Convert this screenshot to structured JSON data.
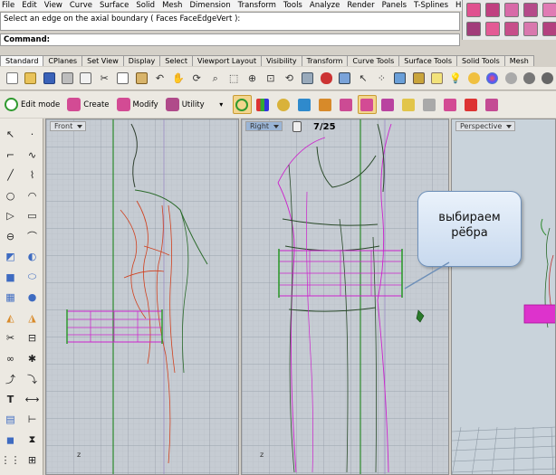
{
  "menu": [
    "File",
    "Edit",
    "View",
    "Curve",
    "Surface",
    "Solid",
    "Mesh",
    "Dimension",
    "Transform",
    "Tools",
    "Analyze",
    "Render",
    "Panels",
    "T-Splines",
    "Help"
  ],
  "command": {
    "history": "Select an edge on the axial boundary ( Faces  FaceEdgeVert ):",
    "prompt": "Command:"
  },
  "tabs": [
    "Standard",
    "CPlanes",
    "Set View",
    "Display",
    "Select",
    "Viewport Layout",
    "Visibility",
    "Transform",
    "Curve Tools",
    "Surface Tools",
    "Solid Tools",
    "Mesh"
  ],
  "toolbar2": {
    "edit_mode": "Edit mode",
    "create": "Create",
    "modify": "Modify",
    "utility": "Utility"
  },
  "viewports": {
    "front": "Front",
    "right": "Right",
    "perspective": "Perspective"
  },
  "counter": "7/25",
  "callout": {
    "line1": "выбираем",
    "line2": "рёбра"
  },
  "axis_label": "z"
}
